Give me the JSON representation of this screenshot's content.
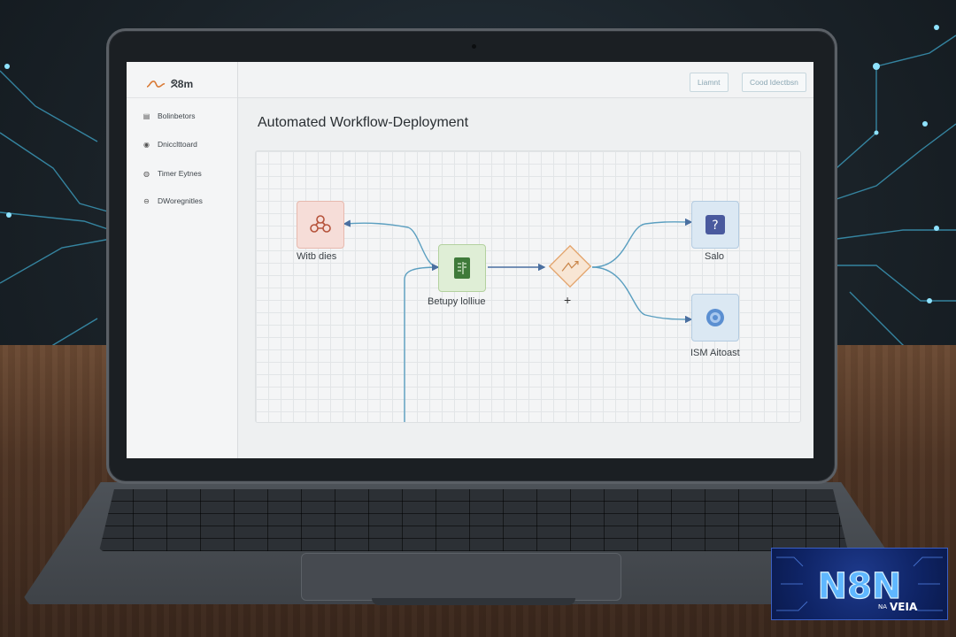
{
  "app": {
    "brand_name": "ᘝ8m",
    "title": "Automated Workflow-Deployment"
  },
  "sidebar": {
    "items": [
      {
        "label": "Bolinbetors",
        "icon": "list-icon"
      },
      {
        "label": "Dnicclttoard",
        "icon": "dashboard-icon"
      },
      {
        "label": "Timer Eytnes",
        "icon": "timer-icon"
      },
      {
        "label": "DWoregnitles",
        "icon": "settings-icon"
      }
    ]
  },
  "header": {
    "buttons": [
      {
        "label": "Liamnt"
      },
      {
        "label": "Cood Idectbsn"
      }
    ]
  },
  "workflow": {
    "nodes": [
      {
        "label": "Witb dies",
        "icon": "webhook-icon",
        "color": "#f6ddd8"
      },
      {
        "label": "Betupy lolliue",
        "icon": "sheets-icon",
        "color": "#dfeed6"
      },
      {
        "label": "",
        "icon": "if-branch-icon",
        "color": "#f8e6d4"
      },
      {
        "label": "Salo",
        "icon": "help-icon",
        "color": "#dbe8f3"
      },
      {
        "label": "ISM Aitoast",
        "icon": "ai-icon",
        "color": "#dbe8f3"
      }
    ],
    "add_symbol": "+"
  },
  "watermark": {
    "title": "N8N",
    "subtitle_left": "NA",
    "subtitle_right": "VEIA"
  },
  "colors": {
    "accent": "#4f78b5",
    "edge": "#5b9fc0",
    "brand_orange": "#d97a35"
  }
}
